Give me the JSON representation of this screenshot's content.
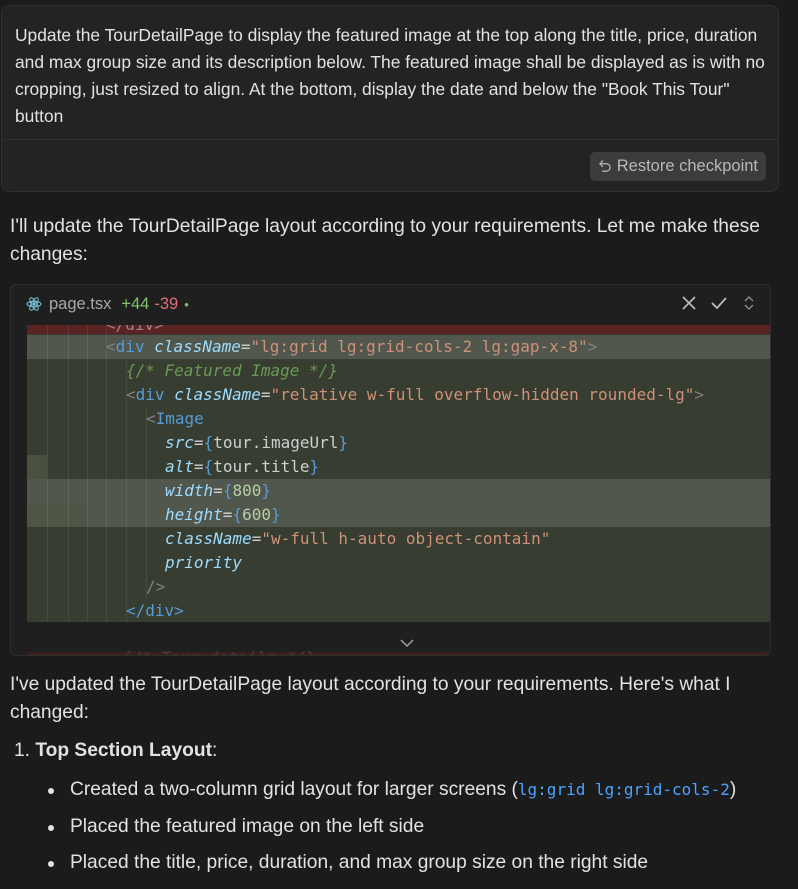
{
  "user_message": {
    "text": "Update the TourDetailPage to display the featured image  at the top along the title, price, duration and max group size and its description below. The featured image shall be displayed as is with no cropping, just resized to align. At the bottom, display the date and below the \"Book This Tour\" button",
    "restore_label": "Restore checkpoint"
  },
  "assistant": {
    "intro": "I'll update the TourDetailPage layout according to your requirements. Let me make these changes:",
    "summary": "I've updated the TourDetailPage layout according to your requirements. Here's what I changed:",
    "list": {
      "item1_number": "1.",
      "item1_title": "Top Section Layout",
      "item1_colon": ":",
      "bullets": [
        {
          "text": "Created a two-column grid layout for larger screens (",
          "code": "lg:grid lg:grid-cols-2",
          "after": ")"
        },
        {
          "text": "Placed the featured image on the left side"
        },
        {
          "text": "Placed the title, price, duration, and max group size on the right side"
        }
      ]
    }
  },
  "code_block": {
    "file_name": "page.tsx",
    "added": "+44",
    "removed": "-39",
    "dot": "•",
    "top_removed_fragment": "</div>",
    "bottom_ghost": "{/* Tour details */}",
    "icons": [
      "react-icon",
      "close-icon",
      "check-icon",
      "expand-icon",
      "chevron-down-icon"
    ],
    "lines": {
      "l1_tag_open": "<",
      "l1_tag": "div",
      "l1_attr": "className",
      "l1_eq": "=",
      "l1_str": "\"lg:grid lg:grid-cols-2 lg:gap-x-8\"",
      "l1_close": ">",
      "l2_comment": "{/* Featured Image */}",
      "l3_tag_open": "<",
      "l3_tag": "div",
      "l3_attr": "className",
      "l3_eq": "=",
      "l3_str": "\"relative w-full overflow-hidden rounded-lg\"",
      "l3_close": ">",
      "l4_tag_open": "<",
      "l4_tag": "Image",
      "l5_attr": "src",
      "l5_eq": "=",
      "l5_open": "{",
      "l5_val": "tour.imageUrl",
      "l5_close": "}",
      "l6_attr": "alt",
      "l6_eq": "=",
      "l6_open": "{",
      "l6_val": "tour.title",
      "l6_close": "}",
      "l7_attr": "width",
      "l7_eq": "=",
      "l7_open": "{",
      "l7_val": "800",
      "l7_close": "}",
      "l8_attr": "height",
      "l8_eq": "=",
      "l8_open": "{",
      "l8_val": "600",
      "l8_close": "}",
      "l9_attr": "className",
      "l9_eq": "=",
      "l9_str": "\"w-full h-auto object-contain\"",
      "l10_attr": "priority",
      "l11_close": "/>",
      "l12_close": "</div>"
    }
  },
  "colors": {
    "background": "#1b1b1c",
    "added_green": "#80c468",
    "removed_red": "#e06c75",
    "diff_added_bg": "#373d30",
    "inline_code_blue": "#4aa3ff"
  }
}
